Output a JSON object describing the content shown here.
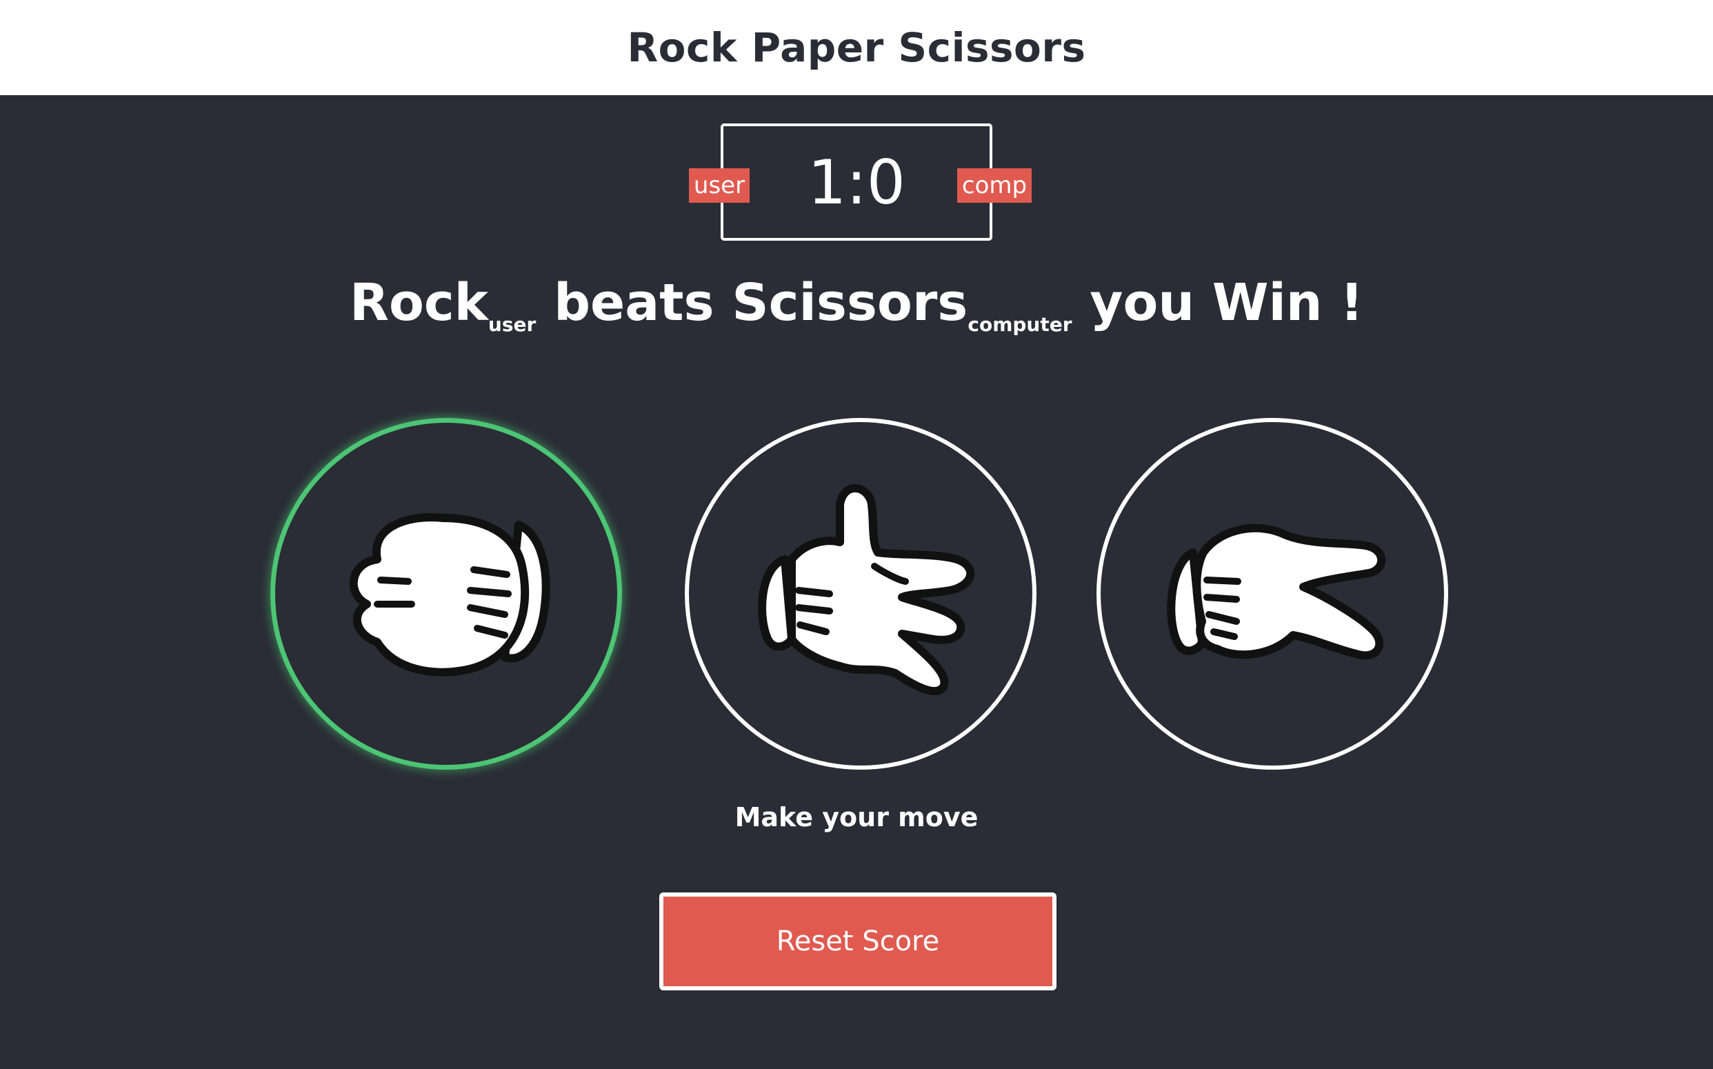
{
  "header": {
    "title": "Rock Paper Scissors"
  },
  "scoreboard": {
    "user_label": "user",
    "comp_label": "comp",
    "score": "1:0",
    "user_score": 1,
    "comp_score": 0
  },
  "result": {
    "user_choice": "Rock",
    "user_sub": "user",
    "verb": "beats",
    "computer_choice": "Scissors",
    "computer_sub": "computer",
    "outcome": "you Win !"
  },
  "choices": [
    {
      "id": "rock",
      "icon": "rock-hand-icon",
      "selected": true
    },
    {
      "id": "paper",
      "icon": "paper-hand-icon",
      "selected": false
    },
    {
      "id": "scissors",
      "icon": "scissors-hand-icon",
      "selected": false
    }
  ],
  "prompt": "Make your move",
  "reset_button": "Reset Score",
  "colors": {
    "background": "#2a2d35",
    "accent_red": "#e05a50",
    "selected_green": "#4cc574",
    "header_bg": "#ffffff"
  }
}
